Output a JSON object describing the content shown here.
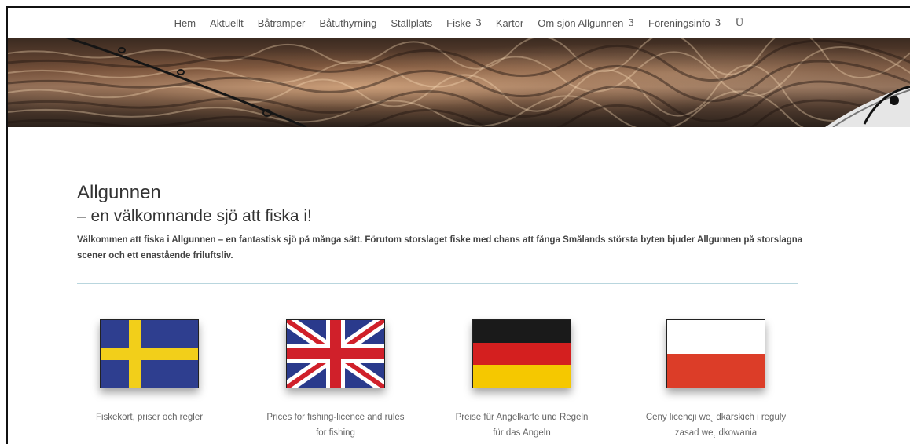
{
  "nav": {
    "items": [
      {
        "label": "Hem"
      },
      {
        "label": "Aktuellt"
      },
      {
        "label": "Båtramper"
      },
      {
        "label": "Båtuthyrning"
      },
      {
        "label": "Ställplats"
      },
      {
        "label": "Fiske",
        "chevron": "3"
      },
      {
        "label": "Kartor"
      },
      {
        "label": "Om sjön Allgunnen",
        "chevron": "3"
      },
      {
        "label": "Föreningsinfo",
        "chevron": "3"
      }
    ],
    "user_glyph": "U"
  },
  "banner": {
    "icon": "fishing-rod-water-image"
  },
  "main": {
    "title": "Allgunnen",
    "subtitle": "– en välkomnande sjö att fiska i!",
    "intro": "Välkommen att fiska i Allgunnen – en fantastisk sjö på många sätt. Förutom storslaget fiske med chans att fånga Smålands största byten bjuder Allgunnen på storslagna scener och ett enastående friluftsliv."
  },
  "languages": [
    {
      "flag": "sweden-flag-icon",
      "label_line1": "Fiskekort, priser och regler",
      "label_line2": ""
    },
    {
      "flag": "uk-flag-icon",
      "label_line1": "Prices for fishing-licence and rules",
      "label_line2": "for fishing"
    },
    {
      "flag": "germany-flag-icon",
      "label_line1": "Preise für Angelkarte und Regeln",
      "label_line2": "für das Angeln"
    },
    {
      "flag": "poland-flag-icon",
      "label_line1": "Ceny licencji we˛ dkarskich i reguly",
      "label_line2": "zasad we˛ dkowania"
    }
  ],
  "colors": {
    "sweden_blue": "#2e3e8f",
    "sweden_yellow": "#f2cf1a",
    "uk_blue": "#2a3a8c",
    "uk_red": "#d0202a",
    "de_black": "#1a1a1a",
    "de_red": "#d41f1f",
    "de_gold": "#f5c800",
    "pl_red": "#dc3d28",
    "divider": "#b9d6de"
  }
}
